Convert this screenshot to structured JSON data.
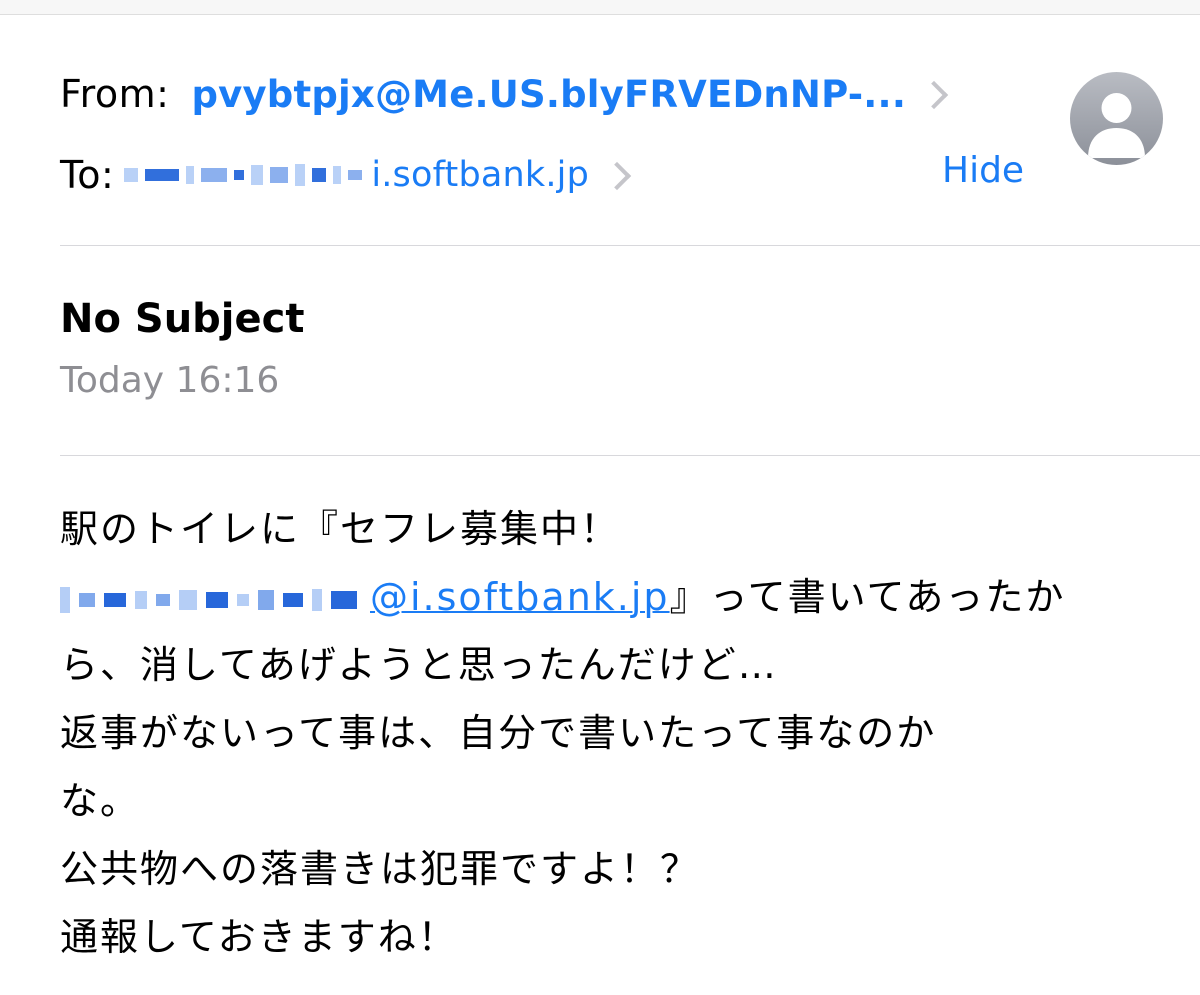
{
  "header": {
    "from_label": "From:",
    "from_address": "pvybtpjx@Me.US.blyFRVEDnNP-...",
    "to_label": "To:",
    "to_address_visible": "i.softbank.jp",
    "hide_label": "Hide",
    "avatar_icon": "person-silhouette-icon"
  },
  "message": {
    "subject": "No Subject",
    "date": "Today 16:16"
  },
  "body": {
    "line1": "駅のトイレに『セフレ募集中！",
    "link": "@i.softbank.jp",
    "line2_tail": "』って書いてあったか",
    "line3": "ら、消してあげようと思ったんだけど…",
    "line4": "返事がないって事は、自分で書いたって事なのか",
    "line5": "な。",
    "line6": "公共物への落書きは犯罪ですよ！？",
    "line7": "通報しておきますね！"
  },
  "colors": {
    "link_blue": "#1a7cf5",
    "secondary_gray": "#8e8e93",
    "divider": "#d8d8dc"
  }
}
